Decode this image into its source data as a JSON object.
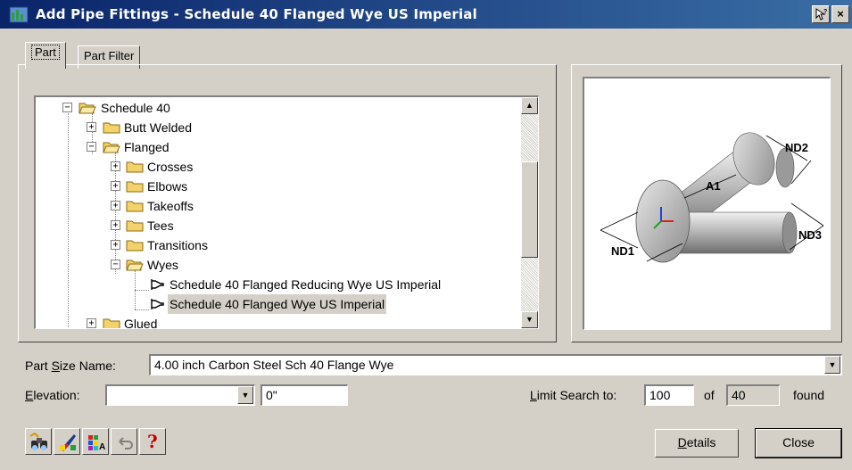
{
  "window": {
    "title": "Add Pipe Fittings - Schedule 40 Flanged Wye US Imperial",
    "help_button": "?",
    "close_button": "×"
  },
  "tabs": [
    {
      "label": "Part",
      "active": true
    },
    {
      "label": "Part Filter",
      "active": false
    }
  ],
  "tree": {
    "items": [
      {
        "label": "Schedule 40",
        "expander": "−",
        "icon": "folder-open-icon"
      },
      {
        "label": "Butt Welded",
        "expander": "+",
        "icon": "folder-icon"
      },
      {
        "label": "Flanged",
        "expander": "−",
        "icon": "folder-open-icon"
      },
      {
        "label": "Crosses",
        "expander": "+",
        "icon": "folder-icon"
      },
      {
        "label": "Elbows",
        "expander": "+",
        "icon": "folder-icon"
      },
      {
        "label": "Takeoffs",
        "expander": "+",
        "icon": "folder-icon"
      },
      {
        "label": "Tees",
        "expander": "+",
        "icon": "folder-icon"
      },
      {
        "label": "Transitions",
        "expander": "+",
        "icon": "folder-icon"
      },
      {
        "label": "Wyes",
        "expander": "−",
        "icon": "folder-open-icon"
      },
      {
        "label": "Schedule 40 Flanged Reducing Wye US Imperial",
        "icon": "part-icon"
      },
      {
        "label": "Schedule 40 Flanged Wye US Imperial",
        "icon": "part-icon",
        "selected": true
      },
      {
        "label": "Glued",
        "expander": "+",
        "icon": "folder-icon"
      }
    ],
    "scroll_up": "▲",
    "scroll_down": "▼"
  },
  "preview": {
    "labels": {
      "nd1": "ND1",
      "nd2": "ND2",
      "nd3": "ND3",
      "a1": "A1"
    }
  },
  "form": {
    "part_size_name": {
      "label_pre": "Part ",
      "label_u": "S",
      "label_post": "ize Name:",
      "value": "4.00 inch Carbon Steel Sch 40 Flange Wye"
    },
    "elevation": {
      "label_u": "E",
      "label_post": "levation:",
      "value": "",
      "offset": "0\""
    },
    "limit_search": {
      "label_u": "L",
      "label_post": "imit Search to:",
      "value": "100",
      "of_label": "of",
      "found_count": "40",
      "found_label": "found"
    },
    "dropdown_glyph": "▼"
  },
  "toolbar": {
    "help_glyph": "?"
  },
  "buttons": {
    "details": {
      "label_u": "D",
      "label_post": "etails"
    },
    "close": "Close"
  },
  "colors": {
    "titlebar_start": "#0a246a",
    "titlebar_end": "#3a6ea5",
    "dialog_face": "#d4d0c8",
    "folder_yellow": "#f3d26b"
  }
}
